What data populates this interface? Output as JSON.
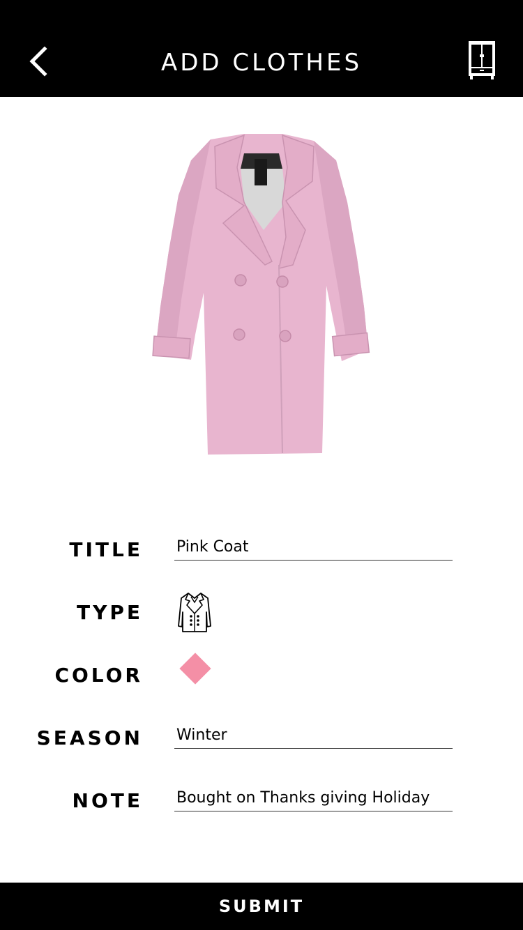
{
  "header": {
    "title": "ADD CLOTHES",
    "back_icon": "chevron-left-icon",
    "wardrobe_icon": "wardrobe-icon"
  },
  "photo": {
    "subject": "pink double-breasted coat",
    "color": "#e8b5cf"
  },
  "form": {
    "title_label": "TITLE",
    "title_value": "Pink Coat",
    "type_label": "TYPE",
    "type_icon": "coat-icon",
    "color_label": "COLOR",
    "color_value": "#f48fa6",
    "season_label": "SEASON",
    "season_value": "Winter",
    "note_label": "NOTE",
    "note_value": "Bought on Thanks giving Holiday"
  },
  "submit_label": "SUBMIT"
}
